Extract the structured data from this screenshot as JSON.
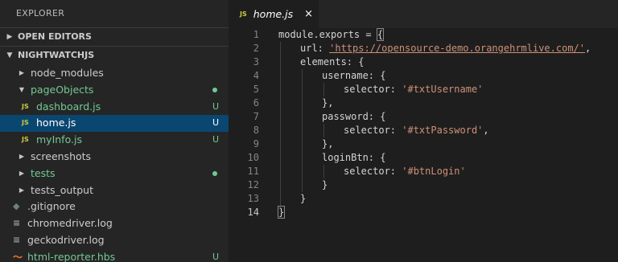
{
  "sidebar": {
    "title": "EXPLORER",
    "open_editors": "OPEN EDITORS",
    "project": "NIGHTWATCHJS",
    "items": [
      {
        "label": "node_modules",
        "status": ""
      },
      {
        "label": "pageObjects",
        "status": ""
      },
      {
        "label": "dashboard.js",
        "status": "U",
        "icon": "JS"
      },
      {
        "label": "home.js",
        "status": "U",
        "icon": "JS"
      },
      {
        "label": "myInfo.js",
        "status": "U",
        "icon": "JS"
      },
      {
        "label": "screenshots",
        "status": ""
      },
      {
        "label": "tests",
        "status": ""
      },
      {
        "label": "tests_output",
        "status": ""
      },
      {
        "label": ".gitignore",
        "status": ""
      },
      {
        "label": "chromedriver.log",
        "status": ""
      },
      {
        "label": "geckodriver.log",
        "status": ""
      },
      {
        "label": "html-reporter.hbs",
        "status": "U"
      }
    ]
  },
  "tab": {
    "icon": "JS",
    "label": "home.js",
    "close": "×"
  },
  "code": {
    "lines": [
      {
        "n": "1",
        "a": "module.exports = ",
        "b": "{"
      },
      {
        "n": "2",
        "a": "url: ",
        "s": "'https://opensource-demo.orangehrmlive.com/'",
        "c": ","
      },
      {
        "n": "3",
        "a": "elements: {"
      },
      {
        "n": "4",
        "a": "username: {"
      },
      {
        "n": "5",
        "a": "selector: ",
        "s": "'#txtUsername'"
      },
      {
        "n": "6",
        "a": "},"
      },
      {
        "n": "7",
        "a": "password: {"
      },
      {
        "n": "8",
        "a": "selector: ",
        "s": "'#txtPassword'",
        "c": ","
      },
      {
        "n": "9",
        "a": "},"
      },
      {
        "n": "10",
        "a": "loginBtn: {"
      },
      {
        "n": "11",
        "a": "selector: ",
        "s": "'#btnLogin'"
      },
      {
        "n": "12",
        "a": "}"
      },
      {
        "n": "13",
        "a": "}"
      },
      {
        "n": "14",
        "b": "}"
      }
    ]
  },
  "colors": {
    "sidebar_bg": "#252526",
    "editor_bg": "#1e1e1e",
    "selection": "#094771",
    "git_untracked": "#73c991",
    "string": "#ce9178",
    "js_icon": "#cbcb41"
  }
}
